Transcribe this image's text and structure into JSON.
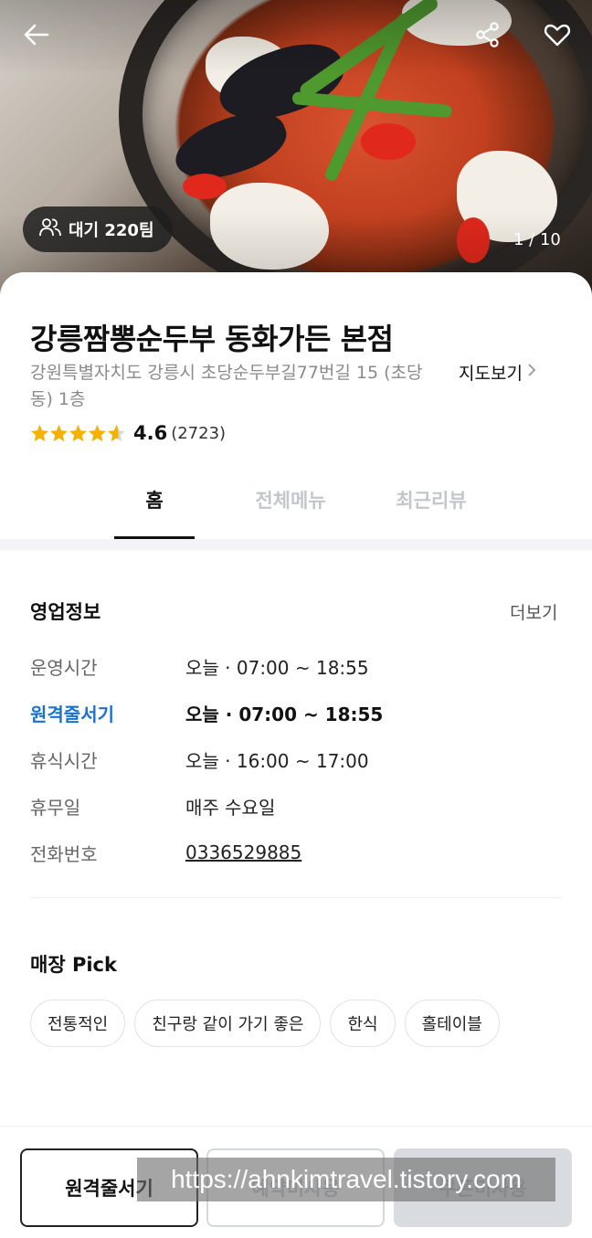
{
  "hero": {
    "wait_badge": "대기 220팀",
    "photo_counter": "1 / 10",
    "icons": [
      "back-arrow-icon",
      "share-icon",
      "heart-icon",
      "people-icon"
    ]
  },
  "store": {
    "name": "강릉짬뽕순두부 동화가든 본점",
    "address": "강원특별자치도 강릉시 초당순두부길77번길 15 (초당동) 1층",
    "map_link": "지도보기",
    "rating": "4.6",
    "review_count": "(2723)",
    "star_rating_value": 4.6
  },
  "tabs": [
    {
      "label": "홈",
      "active": true
    },
    {
      "label": "전체메뉴",
      "active": false
    },
    {
      "label": "최근리뷰",
      "active": false
    }
  ],
  "business_info": {
    "title": "영업정보",
    "more_label": "더보기",
    "rows": [
      {
        "key": "운영시간",
        "value": "오늘 · 07:00 ~ 18:55"
      },
      {
        "key": "원격줄서기",
        "value": "오늘 · 07:00 ~ 18:55"
      },
      {
        "key": "휴식시간",
        "value": "오늘 · 16:00 ~ 17:00"
      },
      {
        "key": "휴무일",
        "value": "매주 수요일"
      },
      {
        "key": "전화번호",
        "value": "0336529885"
      }
    ]
  },
  "store_pick": {
    "title": "매장 Pick",
    "chips": [
      "전통적인",
      "친구랑 같이 가기 좋은",
      "한식",
      "홀테이블"
    ]
  },
  "actions": {
    "remote_queue": "원격줄서기",
    "reserve": "예약미사용",
    "coupon": "쿠폰미사용"
  },
  "watermark": "https://ahnkimtravel.tistory.com",
  "colors": {
    "accent_blue": "#1a73c9",
    "star_yellow": "#f5b100",
    "tab_inactive": "#c3c7cc"
  }
}
